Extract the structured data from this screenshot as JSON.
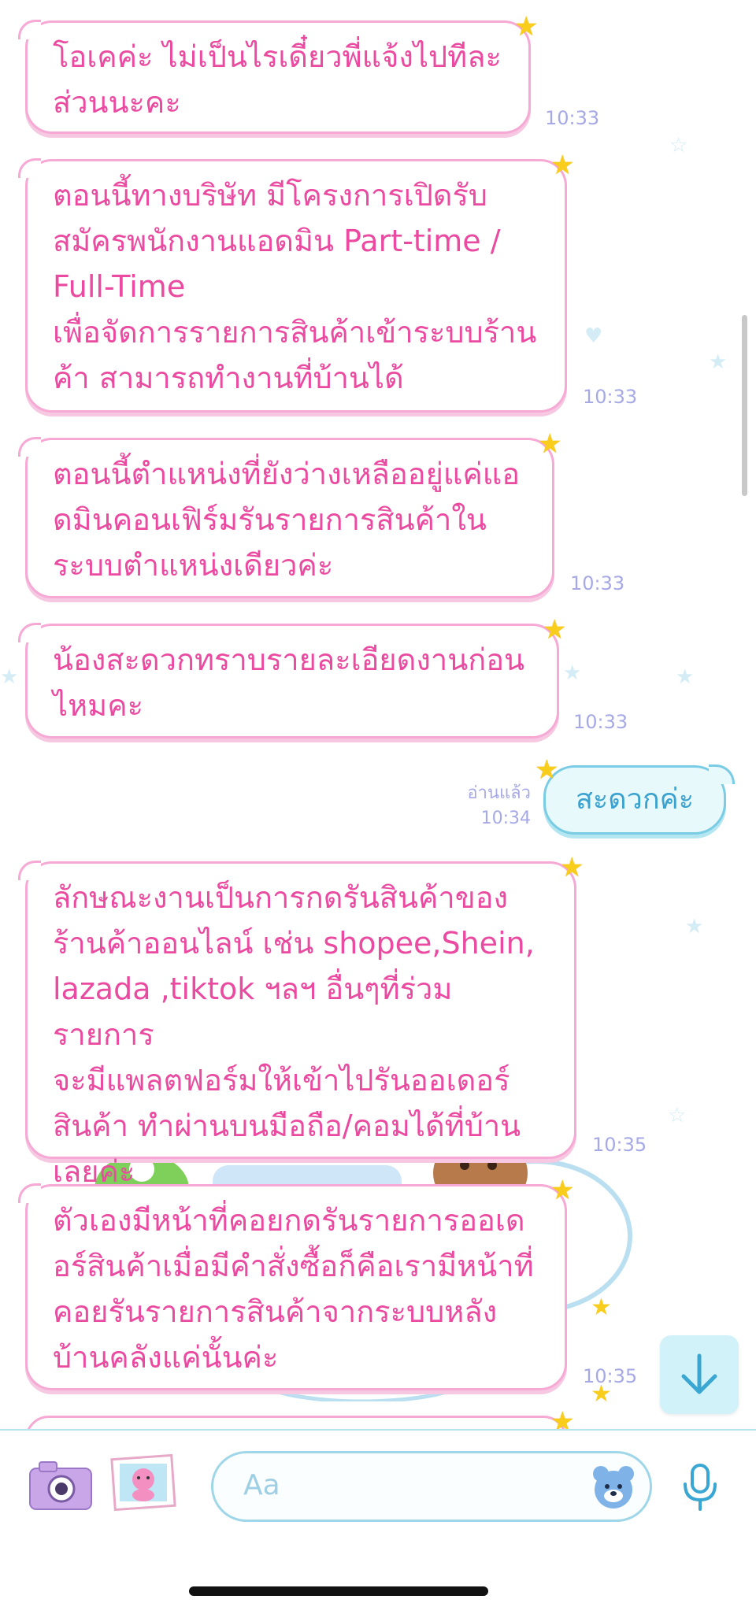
{
  "messages": [
    {
      "text": "โอเคค่ะ ไม่เป็นไรเดี๋ยวพี่แจ้งไปทีละ\nส่วนนะคะ",
      "time": "10:33"
    },
    {
      "text": "ตอนนี้ทางบริษัท มีโครงการเปิดรับ\nสมัครพนักงานแอดมิน Part-time /\nFull-Time\nเพื่อจัดการรายการสินค้าเข้าระบบร้าน\nค้า สามารถทำงานที่บ้านได้",
      "time": "10:33"
    },
    {
      "text": "ตอนนี้ตำแหน่งที่ยังว่างเหลืออยู่แค่แอ\nดมินคอนเฟิร์มรันรายการสินค้าใน\nระบบตำแหน่งเดียวค่ะ",
      "time": "10:33"
    },
    {
      "text": "น้องสะดวกทราบรายละเอียดงานก่อน\nไหมคะ",
      "time": "10:33"
    },
    {
      "text": "ลักษณะงานเป็นการกดรันสินค้าของ\nร้านค้าออนไลน์ เช่น shopee,Shein,\nlazada ,tiktok ฯลฯ อื่นๆที่ร่วมรายการ\nจะมีแพลตฟอร์มให้เข้าไปรันออเดอร์\nสินค้า ทำผ่านบนมือถือ/คอมได้ที่บ้าน\nเลยค่ะ",
      "time": "10:35"
    },
    {
      "text": "ตัวเองมีหน้าที่คอยกดรันรายการออเด\nอร์สินค้าเมื่อมีคำสั่งซื้อก็คือเรามีหน้าที่\nคอยรันรายการสินค้าจากระบบหลัง\nบ้านคลังแค่นั้นค่ะ",
      "time": "10:35"
    }
  ],
  "outgoing": {
    "text": "สะดวกค่ะ",
    "read_label": "อ่านแล้ว",
    "time": "10:34"
  },
  "input": {
    "placeholder": "Aa"
  },
  "icons": {
    "camera": "camera-icon",
    "gallery": "gallery-icon",
    "sticker": "sticker-bear-icon",
    "mic": "microphone-icon",
    "scroll_down": "arrow-down-icon"
  },
  "colors": {
    "incoming_text": "#ea4aa0",
    "incoming_border": "#f6a9d4",
    "outgoing_text": "#3ba2cf",
    "outgoing_border": "#79cce4",
    "time": "#a6a9e6",
    "star": "#f9cd1c"
  }
}
